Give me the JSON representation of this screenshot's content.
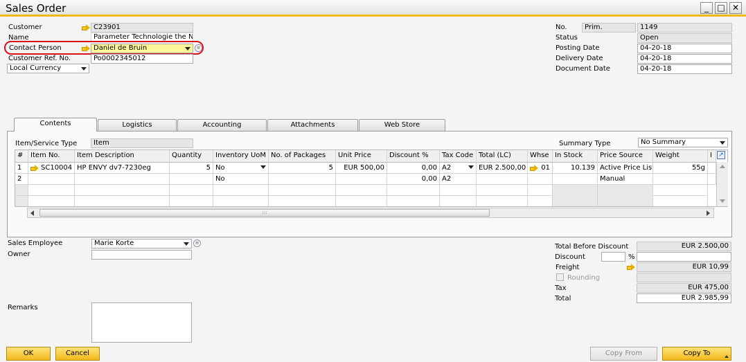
{
  "window": {
    "title": "Sales Order",
    "controls": [
      "_",
      "□",
      "✕"
    ]
  },
  "header_left": {
    "customer": {
      "label": "Customer",
      "value": "C23901"
    },
    "name": {
      "label": "Name",
      "value": "Parameter Technologie the Netherlands"
    },
    "contact_person": {
      "label": "Contact Person",
      "value": "Daniel de Bruin"
    },
    "customer_ref": {
      "label": "Customer Ref. No.",
      "value": "Po0002345012"
    },
    "currency": {
      "value": "Local Currency"
    }
  },
  "header_right": {
    "no": {
      "label": "No.",
      "series": "Prim.",
      "value": "1149"
    },
    "status": {
      "label": "Status",
      "value": "Open"
    },
    "posting_date": {
      "label": "Posting Date",
      "value": "04-20-18"
    },
    "delivery_date": {
      "label": "Delivery Date",
      "value": "04-20-18"
    },
    "document_date": {
      "label": "Document Date",
      "value": "04-20-18"
    }
  },
  "tabs": [
    {
      "label": "Contents",
      "active": true
    },
    {
      "label": "Logistics"
    },
    {
      "label": "Accounting"
    },
    {
      "label": "Attachments"
    },
    {
      "label": "Web Store"
    }
  ],
  "contents": {
    "item_service_type": {
      "label": "Item/Service Type",
      "value": "Item"
    },
    "summary_type": {
      "label": "Summary Type",
      "value": "No Summary"
    },
    "columns": [
      "#",
      "Item No.",
      "Item Description",
      "Quantity",
      "Inventory UoM",
      "No. of Packages",
      "Unit Price",
      "Discount %",
      "Tax Code",
      "Total (LC)",
      "Whse",
      "In Stock",
      "Price Source",
      "Weight",
      "I"
    ],
    "rows": [
      [
        "1",
        "SC10004",
        "HP ENVY dv7-7230eg",
        "5",
        "No",
        "5",
        "EUR 500,00",
        "0,00",
        "A2",
        "EUR 2.500,00",
        "01",
        "10.139",
        "Active Price List",
        "55g"
      ],
      [
        "2",
        "",
        "",
        "",
        "No",
        "",
        "",
        "0,00",
        "A2",
        "",
        "",
        "",
        "Manual",
        ""
      ]
    ],
    "scroll_grip": ":::"
  },
  "footer_left": {
    "sales_employee": {
      "label": "Sales Employee",
      "value": "Marie Korte"
    },
    "owner": {
      "label": "Owner",
      "value": ""
    },
    "remarks": {
      "label": "Remarks",
      "value": ""
    }
  },
  "totals": {
    "total_before_discount": {
      "label": "Total Before Discount",
      "value": "EUR 2.500,00"
    },
    "discount": {
      "label": "Discount",
      "percent_sign": "%",
      "percent": "",
      "value": ""
    },
    "freight": {
      "label": "Freight",
      "value": "EUR 10,99"
    },
    "rounding": {
      "label": "Rounding",
      "value": ""
    },
    "tax": {
      "label": "Tax",
      "value": "EUR 475,00"
    },
    "total": {
      "label": "Total",
      "value": "EUR 2.985,99"
    }
  },
  "buttons": {
    "ok": "OK",
    "cancel": "Cancel",
    "copy_from": "Copy From",
    "copy_to": "Copy To"
  }
}
